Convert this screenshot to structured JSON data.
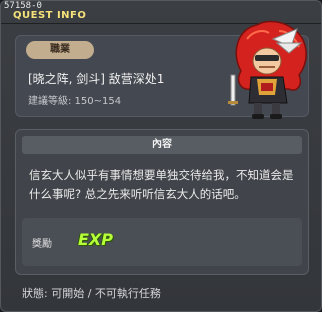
{
  "window": {
    "quest_id": "57158-0",
    "title": "QUEST INFO"
  },
  "header": {
    "job_badge": "職業",
    "quest_name": "[晓之阵, 剑斗] 敌营深处1",
    "level_range": "建議等級: 150~154"
  },
  "content": {
    "heading": "內容",
    "description": "信玄大人似乎有事情想要单独交待给我，不知道会是什么事呢? 总之先来听听信玄大人的话吧。",
    "reward_label": "獎勵",
    "reward_exp": "EXP"
  },
  "status": {
    "text": "狀態: 可開始 / 不可執行任務"
  },
  "colors": {
    "title_yellow": "#f6e27b",
    "badge_tan": "#c2ad8f",
    "exp_green": "#b6ff3a",
    "panel_bg": "#444850"
  },
  "icons": [
    "warrior-avatar-icon"
  ]
}
